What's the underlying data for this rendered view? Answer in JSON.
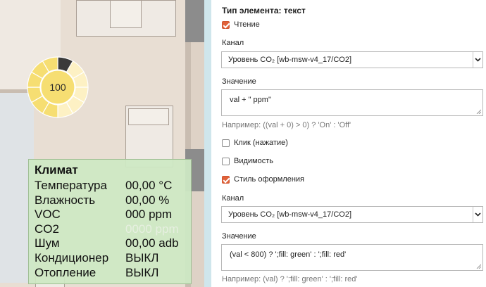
{
  "climate_widget": {
    "title": "Климат",
    "rows": [
      {
        "label": "Температура",
        "value": "00,00 °C",
        "dim": false
      },
      {
        "label": "Влажность",
        "value": "00,00 %",
        "dim": false
      },
      {
        "label": "VOC",
        "value": "000 ppm",
        "dim": false
      },
      {
        "label": "CO2",
        "value": "0000 ppm",
        "dim": true
      },
      {
        "label": "Шум",
        "value": "00,00 adb",
        "dim": false
      },
      {
        "label": "Кондиционер",
        "value": "ВЫКЛ",
        "dim": false
      },
      {
        "label": "Отопление",
        "value": "ВЫКЛ",
        "dim": false
      }
    ]
  },
  "dimmer": {
    "value": "100",
    "level": 1.0,
    "colors": {
      "lit": "#f6de72",
      "pale": "#fdf1c4",
      "selected": "#3a3a3a"
    }
  },
  "panel": {
    "heading": "Тип элемента: текст",
    "read": {
      "label": "Чтение",
      "checked": true
    },
    "channel1": {
      "label": "Канал",
      "value": "Уровень CO₂ [wb-msw-v4_17/CO2]"
    },
    "value1": {
      "label": "Значение",
      "value": "val + \" ppm\"",
      "hint": "Например: ((val + 0) > 0) ? 'On' : 'Off'"
    },
    "click": {
      "label": "Клик (нажатие)",
      "checked": false
    },
    "visibility": {
      "label": "Видимость",
      "checked": false
    },
    "style": {
      "label": "Стиль оформления",
      "checked": true
    },
    "channel2": {
      "label": "Канал",
      "value": "Уровень CO₂ [wb-msw-v4_17/CO2]"
    },
    "value2": {
      "label": "Значение",
      "value": "(val < 800) ? ';fill: green' : ';fill: red'",
      "hint": "Например: (val) ? ';fill: green' : ';fill: red'"
    }
  },
  "colors": {
    "accent": "#e0623a",
    "widget_bg": "#cde8c4",
    "plan_bg": "#e8ded3"
  }
}
